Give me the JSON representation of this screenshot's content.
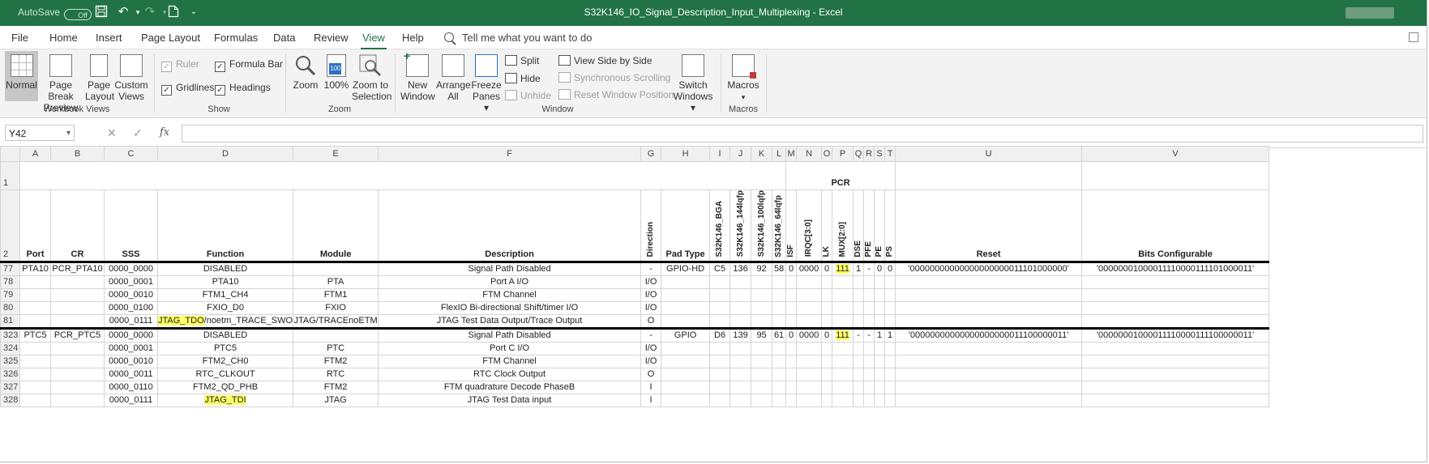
{
  "titlebar": {
    "autosave": "AutoSave",
    "autosave_state": "Off",
    "title": "S32K146_IO_Signal_Description_Input_Multiplexing  -  Excel"
  },
  "tabs": [
    "File",
    "Home",
    "Insert",
    "Page Layout",
    "Formulas",
    "Data",
    "Review",
    "View",
    "Help"
  ],
  "tellme": "Tell me what you want to do",
  "ribbon": {
    "workbook_views": {
      "label": "Workbook Views",
      "normal": "Normal",
      "page_break": "Page Break",
      "page_break2": "Preview",
      "page_layout": "Page",
      "page_layout2": "Layout",
      "custom": "Custom",
      "custom2": "Views"
    },
    "show": {
      "label": "Show",
      "ruler": "Ruler",
      "formula_bar": "Formula Bar",
      "gridlines": "Gridlines",
      "headings": "Headings"
    },
    "zoom": {
      "label": "Zoom",
      "zoom": "Zoom",
      "hundred": "100%",
      "zoom_sel": "Zoom to",
      "zoom_sel2": "Selection"
    },
    "window": {
      "label": "Window",
      "new": "New",
      "new2": "Window",
      "arrange": "Arrange",
      "arrange2": "All",
      "freeze": "Freeze",
      "freeze2": "Panes ▾",
      "split": "Split",
      "hide": "Hide",
      "unhide": "Unhide",
      "side": "View Side by Side",
      "sync": "Synchronous Scrolling",
      "reset": "Reset Window Position",
      "switch": "Switch",
      "switch2": "Windows ▾"
    },
    "macros": {
      "label": "Macros",
      "macros": "Macros",
      "arrow": "▾"
    }
  },
  "formula": {
    "namebox": "Y42",
    "cancel": "✕",
    "enter": "✓",
    "fx": "fx",
    "value": ""
  },
  "columns": [
    "A",
    "B",
    "C",
    "D",
    "E",
    "F",
    "G",
    "H",
    "I",
    "J",
    "K",
    "L",
    "M",
    "N",
    "O",
    "P",
    "Q",
    "R",
    "S",
    "T",
    "U",
    "V"
  ],
  "header1": {
    "rownum": "1",
    "pcr": "PCR"
  },
  "header2": {
    "rownum": "2",
    "port": "Port",
    "cr": "CR",
    "sss": "SSS",
    "function": "Function",
    "module": "Module",
    "description": "Description",
    "direction": "Direction",
    "padtype": "Pad Type",
    "bga": "S32K146_BGA",
    "lq144": "S32K146_144lqfp",
    "lq100": "S32K146_100lqfp",
    "lq64": "S32K146_64lqfp",
    "isf": "ISF",
    "irqc": "IRQC[3:0]",
    "lk": "LK",
    "mux": "MUX[2:0]",
    "dse": "DSE",
    "pfe": "PFE",
    "pe": "PE",
    "ps": "PS",
    "reset": "Reset",
    "bits": "Bits Configurable"
  },
  "rows": [
    {
      "rn": "77",
      "port": "PTA10",
      "cr": "PCR_PTA10",
      "sss": "0000_0000",
      "fn": "DISABLED",
      "fn_hl": "",
      "fn_rest": "",
      "mod": "",
      "desc": "Signal Path Disabled",
      "dir": "-",
      "pad": "GPIO-HD",
      "bga": "C5",
      "l144": "136",
      "l100": "92",
      "l64": "58",
      "isf": "0",
      "irqc": "0000",
      "lk": "0",
      "mux": "111",
      "dse": "1",
      "pfe": "-",
      "pe": "0",
      "ps": "0",
      "reset": "'00000000000000000000011101000000'",
      "bits": "'00000001000011110000111101000011'"
    },
    {
      "rn": "78",
      "port": "",
      "cr": "",
      "sss": "0000_0001",
      "fn": "PTA10",
      "fn_hl": "",
      "fn_rest": "",
      "mod": "PTA",
      "desc": "Port A I/O",
      "dir": "I/O",
      "pad": "",
      "bga": "",
      "l144": "",
      "l100": "",
      "l64": "",
      "isf": "",
      "irqc": "",
      "lk": "",
      "mux": "",
      "dse": "",
      "pfe": "",
      "pe": "",
      "ps": "",
      "reset": "",
      "bits": ""
    },
    {
      "rn": "79",
      "port": "",
      "cr": "",
      "sss": "0000_0010",
      "fn": "FTM1_CH4",
      "fn_hl": "",
      "fn_rest": "",
      "mod": "FTM1",
      "desc": "FTM Channel",
      "dir": "I/O",
      "pad": "",
      "bga": "",
      "l144": "",
      "l100": "",
      "l64": "",
      "isf": "",
      "irqc": "",
      "lk": "",
      "mux": "",
      "dse": "",
      "pfe": "",
      "pe": "",
      "ps": "",
      "reset": "",
      "bits": ""
    },
    {
      "rn": "80",
      "port": "",
      "cr": "",
      "sss": "0000_0100",
      "fn": "FXIO_D0",
      "fn_hl": "",
      "fn_rest": "",
      "mod": "FXIO",
      "desc": "FlexIO Bi-directional Shift/timer I/O",
      "dir": "I/O",
      "pad": "",
      "bga": "",
      "l144": "",
      "l100": "",
      "l64": "",
      "isf": "",
      "irqc": "",
      "lk": "",
      "mux": "",
      "dse": "",
      "pfe": "",
      "pe": "",
      "ps": "",
      "reset": "",
      "bits": ""
    },
    {
      "rn": "81",
      "port": "",
      "cr": "",
      "sss": "0000_0111",
      "fn": "",
      "fn_hl": "JTAG_TDO",
      "fn_rest": "/noetm_TRACE_SWO",
      "mod": "JTAG/TRACEnoETM",
      "desc": "JTAG Test Data Output/Trace Output",
      "dir": "O",
      "pad": "",
      "bga": "",
      "l144": "",
      "l100": "",
      "l64": "",
      "isf": "",
      "irqc": "",
      "lk": "",
      "mux": "",
      "dse": "",
      "pfe": "",
      "pe": "",
      "ps": "",
      "reset": "",
      "bits": ""
    },
    {
      "rn": "323",
      "port": "PTC5",
      "cr": "PCR_PTC5",
      "sss": "0000_0000",
      "fn": "DISABLED",
      "fn_hl": "",
      "fn_rest": "",
      "mod": "",
      "desc": "Signal Path Disabled",
      "dir": "-",
      "pad": "GPIO",
      "bga": "D6",
      "l144": "139",
      "l100": "95",
      "l64": "61",
      "isf": "0",
      "irqc": "0000",
      "lk": "0",
      "mux": "111",
      "dse": "-",
      "pfe": "-",
      "pe": "1",
      "ps": "1",
      "reset": "'00000000000000000000011100000011'",
      "bits": "'00000001000011110000111100000011'"
    },
    {
      "rn": "324",
      "port": "",
      "cr": "",
      "sss": "0000_0001",
      "fn": "PTC5",
      "fn_hl": "",
      "fn_rest": "",
      "mod": "PTC",
      "desc": "Port C I/O",
      "dir": "I/O",
      "pad": "",
      "bga": "",
      "l144": "",
      "l100": "",
      "l64": "",
      "isf": "",
      "irqc": "",
      "lk": "",
      "mux": "",
      "dse": "",
      "pfe": "",
      "pe": "",
      "ps": "",
      "reset": "",
      "bits": ""
    },
    {
      "rn": "325",
      "port": "",
      "cr": "",
      "sss": "0000_0010",
      "fn": "FTM2_CH0",
      "fn_hl": "",
      "fn_rest": "",
      "mod": "FTM2",
      "desc": "FTM Channel",
      "dir": "I/O",
      "pad": "",
      "bga": "",
      "l144": "",
      "l100": "",
      "l64": "",
      "isf": "",
      "irqc": "",
      "lk": "",
      "mux": "",
      "dse": "",
      "pfe": "",
      "pe": "",
      "ps": "",
      "reset": "",
      "bits": ""
    },
    {
      "rn": "326",
      "port": "",
      "cr": "",
      "sss": "0000_0011",
      "fn": "RTC_CLKOUT",
      "fn_hl": "",
      "fn_rest": "",
      "mod": "RTC",
      "desc": "RTC Clock Output",
      "dir": "O",
      "pad": "",
      "bga": "",
      "l144": "",
      "l100": "",
      "l64": "",
      "isf": "",
      "irqc": "",
      "lk": "",
      "mux": "",
      "dse": "",
      "pfe": "",
      "pe": "",
      "ps": "",
      "reset": "",
      "bits": ""
    },
    {
      "rn": "327",
      "port": "",
      "cr": "",
      "sss": "0000_0110",
      "fn": "FTM2_QD_PHB",
      "fn_hl": "",
      "fn_rest": "",
      "mod": "FTM2",
      "desc": "FTM quadrature Decode PhaseB",
      "dir": "I",
      "pad": "",
      "bga": "",
      "l144": "",
      "l100": "",
      "l64": "",
      "isf": "",
      "irqc": "",
      "lk": "",
      "mux": "",
      "dse": "",
      "pfe": "",
      "pe": "",
      "ps": "",
      "reset": "",
      "bits": ""
    },
    {
      "rn": "328",
      "port": "",
      "cr": "",
      "sss": "0000_0111",
      "fn": "",
      "fn_hl": "JTAG_TDI",
      "fn_rest": "",
      "mod": "JTAG",
      "desc": "JTAG Test Data input",
      "dir": "I",
      "pad": "",
      "bga": "",
      "l144": "",
      "l100": "",
      "l64": "",
      "isf": "",
      "irqc": "",
      "lk": "",
      "mux": "",
      "dse": "",
      "pfe": "",
      "pe": "",
      "ps": "",
      "reset": "",
      "bits": ""
    }
  ]
}
